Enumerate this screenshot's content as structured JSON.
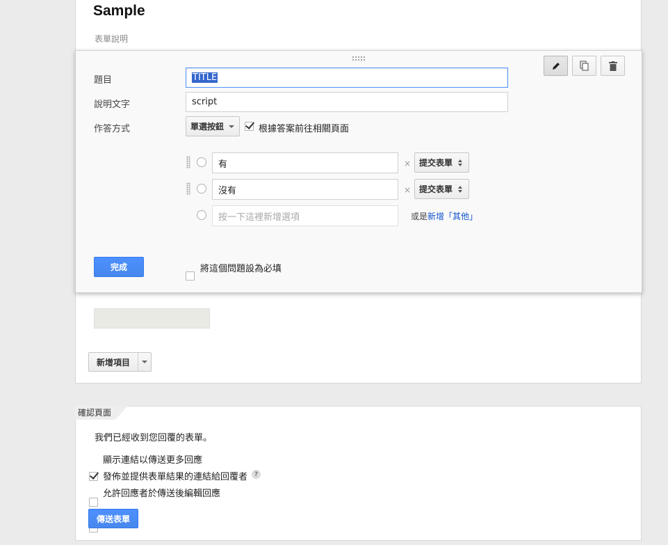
{
  "form": {
    "title": "Sample",
    "description": "表單說明"
  },
  "question": {
    "title_label": "題目",
    "title_value": "TITLE",
    "help_label": "說明文字",
    "help_value": "script",
    "type_label": "作答方式",
    "type_value": "單選按鈕",
    "goto_page_label": "根據答案前往相關頁面",
    "goto_page_checked": true,
    "options": [
      {
        "value": "有",
        "goto": "提交表單"
      },
      {
        "value": "沒有",
        "goto": "提交表單"
      }
    ],
    "new_option_placeholder": "按一下這裡新增選項",
    "add_other_prefix": "或是",
    "add_other_link": "新增「其他」",
    "remove_symbol": "×",
    "done_label": "完成",
    "required_label": "將這個問題設為必填",
    "required_checked": false
  },
  "toolbar": {
    "icons": [
      "pencil-icon",
      "duplicate-icon",
      "trash-icon"
    ]
  },
  "add_item": {
    "label": "新增項目"
  },
  "confirmation": {
    "tab_label": "確認頁面",
    "message": "我們已經收到您回覆的表單。",
    "options": [
      {
        "label": "顯示連結以傳送更多回應",
        "checked": true
      },
      {
        "label": "發佈並提供表單結果的連結給回覆者",
        "checked": false,
        "help": "?"
      },
      {
        "label": "允許回應者於傳送後編輯回應",
        "checked": false
      }
    ],
    "submit_label": "傳送表單"
  },
  "colors": {
    "accent": "#4d90fe",
    "link": "#1155cc",
    "selection": "#3366cc"
  }
}
